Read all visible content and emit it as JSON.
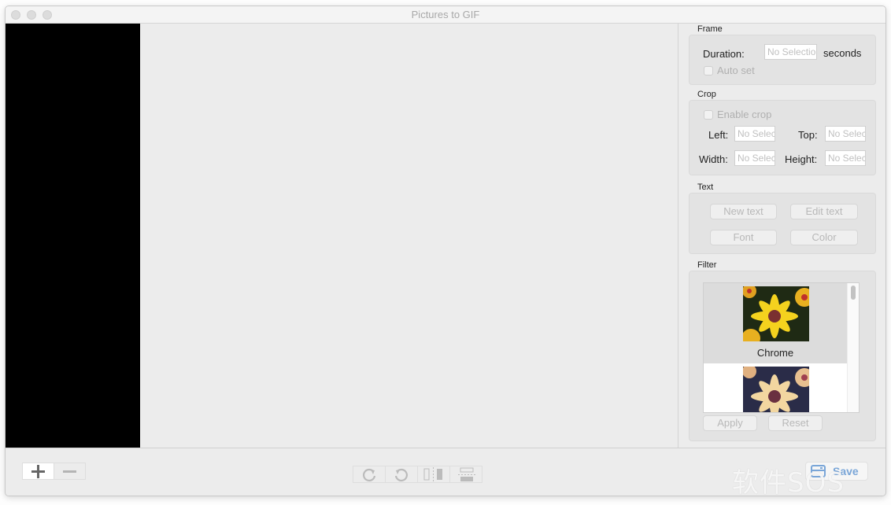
{
  "window": {
    "title": "Pictures to GIF"
  },
  "frame": {
    "section_label": "Frame",
    "duration_label": "Duration:",
    "duration_placeholder": "No Selection",
    "duration_unit": "seconds",
    "auto_set_label": "Auto set",
    "auto_set_checked": false
  },
  "crop": {
    "section_label": "Crop",
    "enable_label": "Enable crop",
    "enable_checked": false,
    "left_label": "Left:",
    "top_label": "Top:",
    "width_label": "Width:",
    "height_label": "Height:",
    "field_placeholder": "No Selection"
  },
  "text": {
    "section_label": "Text",
    "new_text_label": "New text",
    "edit_text_label": "Edit text",
    "font_label": "Font",
    "color_label": "Color"
  },
  "filter": {
    "section_label": "Filter",
    "items": [
      {
        "name": "Chrome",
        "selected": true
      },
      {
        "name": "",
        "selected": false
      }
    ],
    "apply_label": "Apply",
    "reset_label": "Reset"
  },
  "toolbar": {
    "add_icon": "plus-icon",
    "remove_icon": "minus-icon",
    "rotate_cw_icon": "rotate-clockwise-icon",
    "rotate_ccw_icon": "rotate-counterclockwise-icon",
    "flip_h_icon": "flip-horizontal-icon",
    "flip_v_icon": "flip-vertical-icon",
    "save_label": "Save",
    "save_icon": "save-disk-icon"
  },
  "watermark": {
    "text": "软件SOS"
  },
  "colors": {
    "accent": "#4a90e2",
    "disabled_text": "#b8b8b8",
    "thumb_bg": "#000000"
  }
}
